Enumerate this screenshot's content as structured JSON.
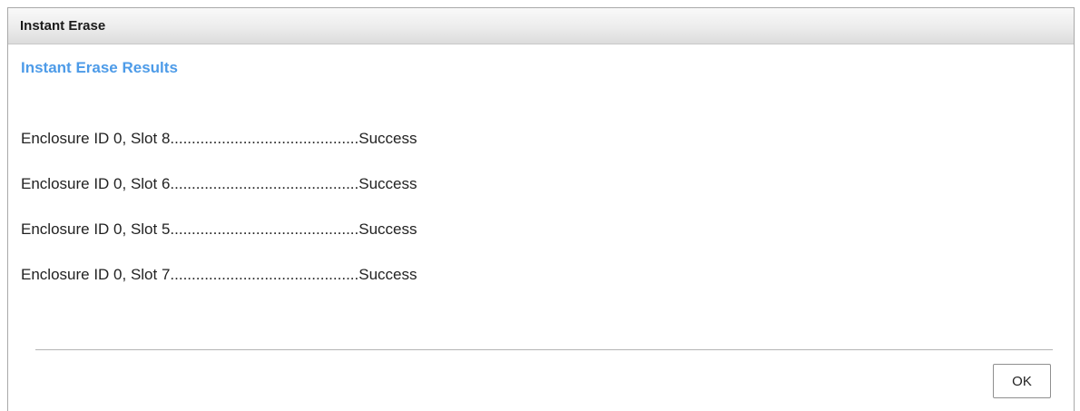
{
  "dialog": {
    "title": "Instant Erase",
    "heading": "Instant Erase Results",
    "results": [
      "Enclosure ID 0, Slot 8............................................Success",
      "Enclosure ID 0, Slot 6............................................Success",
      "Enclosure ID 0, Slot 5............................................Success",
      "Enclosure ID 0, Slot 7............................................Success"
    ],
    "ok_label": "OK"
  }
}
